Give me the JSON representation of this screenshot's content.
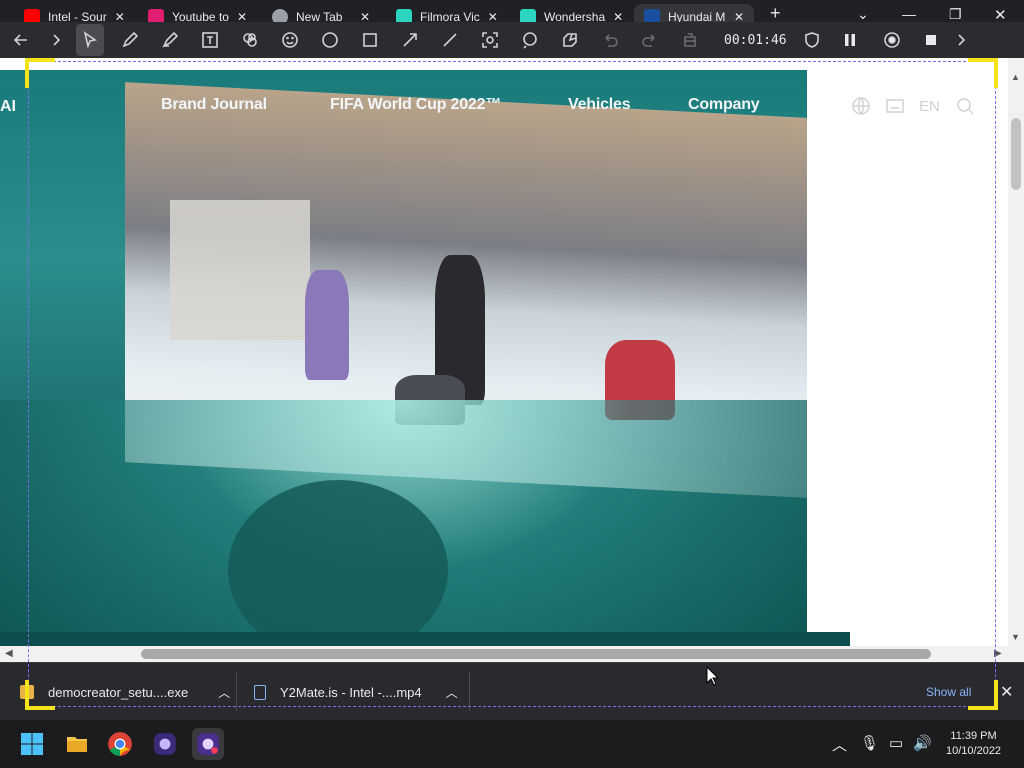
{
  "tabs": [
    {
      "title": "Intel - Sour",
      "favicon_color": "#ff0000"
    },
    {
      "title": "Youtube to",
      "favicon_color": "#e11d74"
    },
    {
      "title": "New Tab",
      "favicon_color": "#9aa0a6"
    },
    {
      "title": "Filmora Vic",
      "favicon_color": "#2dd4bf"
    },
    {
      "title": "Wondersha",
      "favicon_color": "#2dd4bf"
    },
    {
      "title": "Hyundai M",
      "favicon_color": "#1a4fa0"
    }
  ],
  "window_controls": {
    "new_tab": "+",
    "dropdown": "⌄",
    "minimize": "—",
    "restore": "❐",
    "close": "✕"
  },
  "recorder": {
    "timer": "00:01:46",
    "tools": [
      "chevron-right-icon",
      "select-arrow-icon",
      "pen-icon",
      "highlighter-icon",
      "text-icon",
      "stamp-icon",
      "emoji-icon",
      "circle-icon",
      "square-icon",
      "arrow-icon",
      "line-icon",
      "spotlight-icon",
      "magnifier-icon",
      "eraser-icon",
      "undo-icon",
      "redo-icon",
      "clear-icon"
    ]
  },
  "site": {
    "logo_fragment": "AI",
    "nav": [
      "Brand Journal",
      "FIFA World Cup 2022™",
      "Vehicles",
      "Company"
    ],
    "lang": "EN"
  },
  "downloads": {
    "items": [
      {
        "name": "democreator_setu....exe"
      },
      {
        "name": "Y2Mate.is - Intel -....mp4"
      }
    ],
    "show_all": "Show all"
  },
  "taskbar": {
    "time": "11:39 PM",
    "date": "10/10/2022"
  },
  "colors": {
    "selection_dash": "#7c6cf0",
    "selection_corner": "#f4e21b",
    "show_all_link": "#8ab4f8"
  }
}
